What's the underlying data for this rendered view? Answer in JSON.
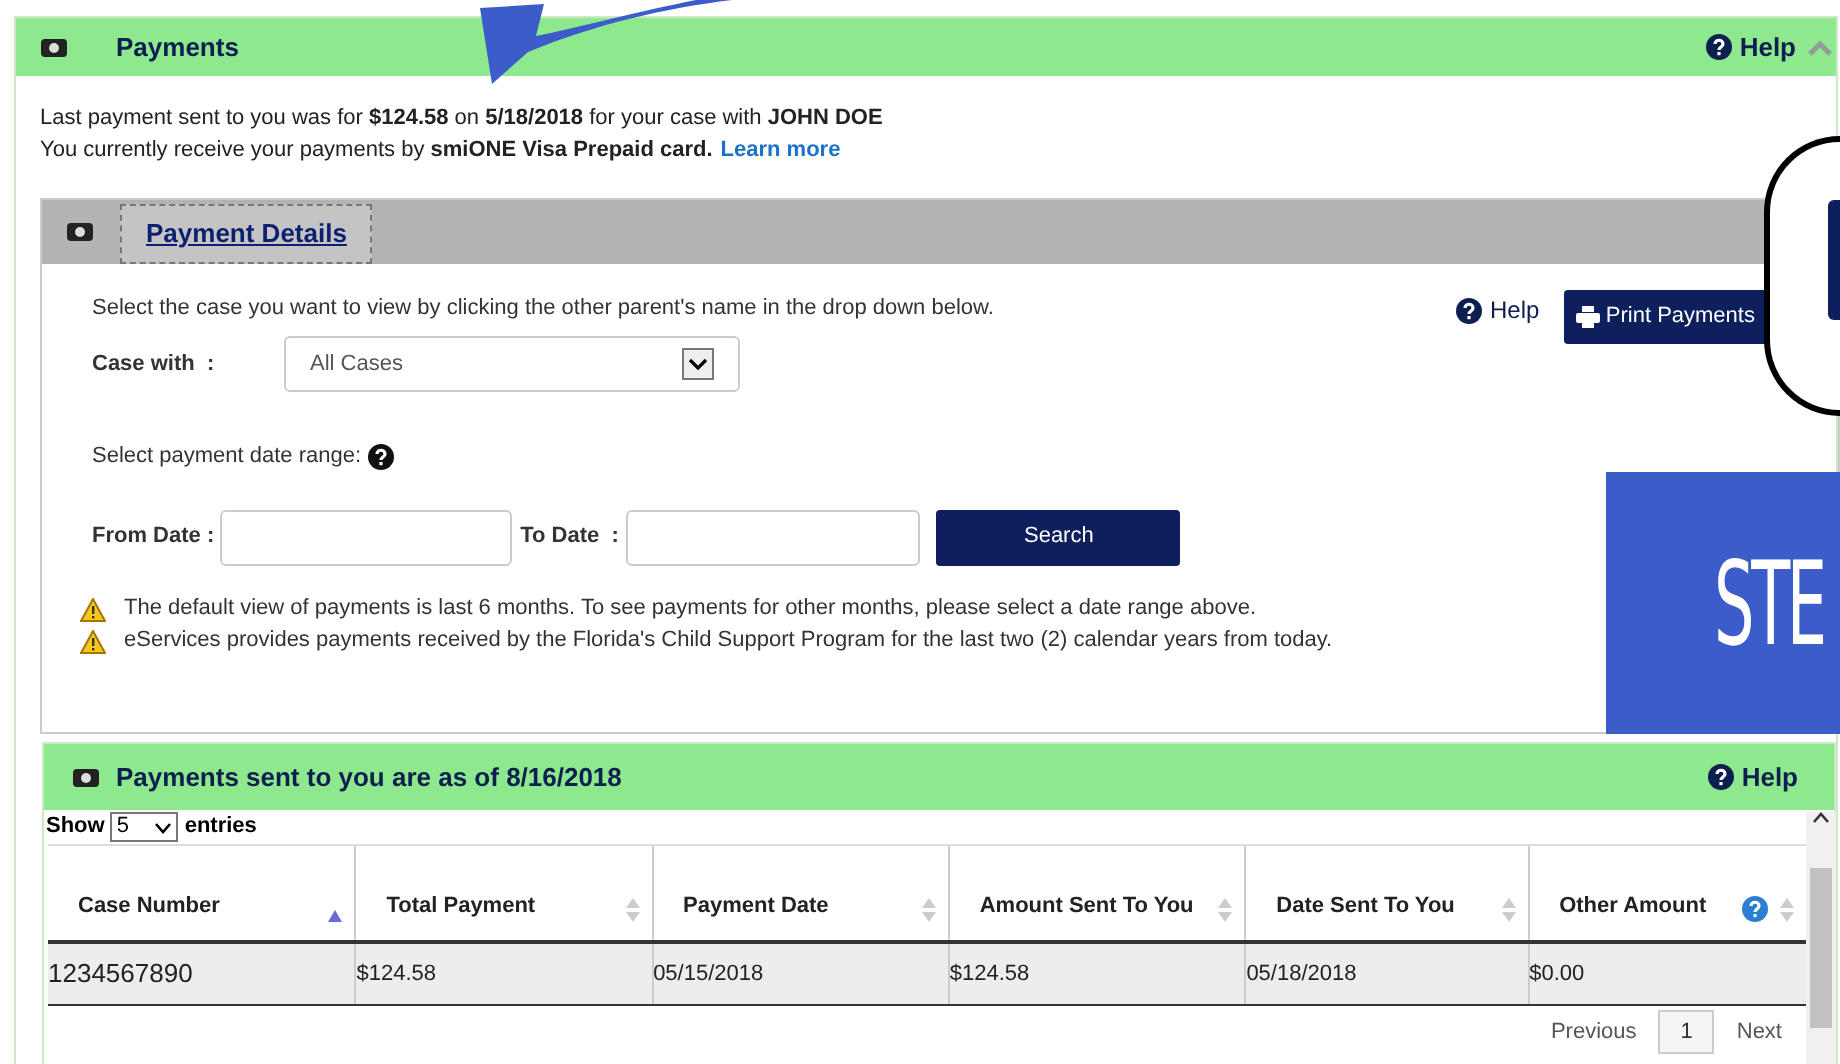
{
  "payments_panel": {
    "title": "Payments",
    "help": "Help",
    "expanded": true,
    "summary_line_1": "Last payment sent to you was for **$124.58** on **5/18/2018** for your case with **JOHN DOE**",
    "summary_line_2": "You currently receive your payments by **smiONE Visa Prepaid card.**",
    "learn_more": "Learn more"
  },
  "details_panel": {
    "tab": "Payment Details",
    "instruction": "Select the case you want to view by clicking the other parent's name in the drop down below.",
    "help": "Help",
    "print_button": "Print Payments",
    "case_label": "Case with  :",
    "case_select": "All Cases",
    "date_range_label": "Select payment date range:",
    "from_label": "From Date :",
    "to_label": "To Date  :",
    "search_button": "Search",
    "notes": [
      "The default view of payments is last 6 months. To see payments for other months, please select a date range above.",
      "eServices provides payments received by the Florida's Child Support Program for the last two (2) calendar years from today."
    ]
  },
  "sent_panel": {
    "title": "Payments sent to you are as of 8/16/2018",
    "help": "Help",
    "show": "Show",
    "entries_select": "5",
    "entries": "entries",
    "columns": [
      {
        "label": "Case Number",
        "sorted": true,
        "help": false
      },
      {
        "label": "Total Payment",
        "sorted": false,
        "help": false
      },
      {
        "label": "Payment Date",
        "sorted": false,
        "help": false
      },
      {
        "label": "Amount Sent To You",
        "sorted": false,
        "help": false
      },
      {
        "label": "Date Sent To You",
        "sorted": false,
        "help": false
      },
      {
        "label": "Other Amount",
        "sorted": false,
        "help": true
      }
    ],
    "rows": [
      [
        "1234567890",
        "$124.58",
        "05/15/2018",
        "$124.58",
        "05/18/2018",
        "$0.00"
      ]
    ],
    "pagination": [
      {
        "label": "Previous",
        "selected": false
      },
      {
        "label": "1",
        "selected": true
      },
      {
        "label": "Next",
        "selected": false
      }
    ]
  },
  "overlay": {
    "banner_text": "STE"
  }
}
